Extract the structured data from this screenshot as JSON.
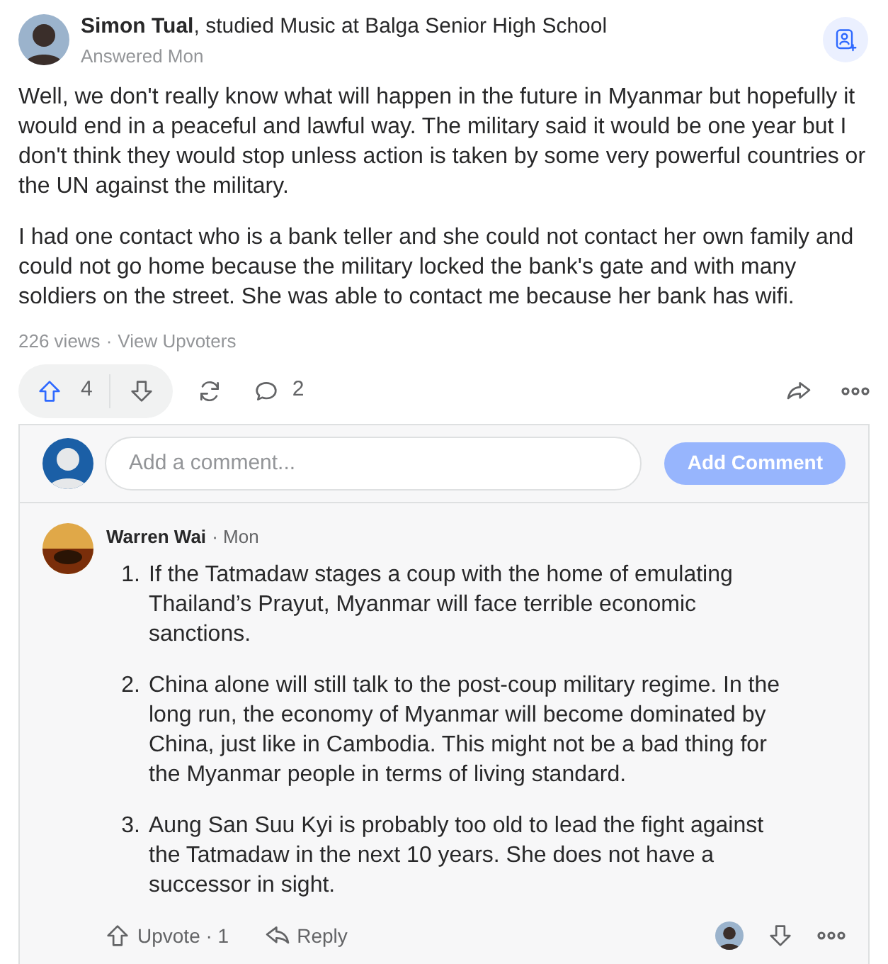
{
  "answer": {
    "author": "Simon Tual",
    "credential": ", studied Music at Balga Senior High School",
    "meta": "Answered Mon",
    "paragraphs": [
      "Well, we don't really know what will happen in the future in Myanmar but hopefully it would end in a peaceful and lawful way. The military said it would be one year but I don't think they would stop unless action is taken by some very powerful countries or the UN against the military.",
      "I had one contact who is a bank teller and she could not contact her own family and could not go home because the military locked the bank's gate and with many soldiers on the street. She was able to contact me because her bank has wifi."
    ],
    "views": "226 views",
    "separator": "·",
    "view_upvoters": "View Upvoters",
    "upvotes": "4",
    "comments": "2"
  },
  "comment_box": {
    "placeholder": "Add a comment...",
    "button": "Add Comment"
  },
  "comments": [
    {
      "author": "Warren Wai",
      "time": "· Mon",
      "points": [
        {
          "number": "1.",
          "text": "If the Tatmadaw stages a coup with the home of emulating Thailand’s Prayut, Myanmar will face terrible economic sanctions."
        },
        {
          "number": "2.",
          "text": "China alone will still talk to the post-coup military regime. In the long run, the economy of Myanmar will become dominated by China, just like in Cambodia. This might not be a bad thing for the Myanmar people in terms of living standard."
        },
        {
          "number": "3.",
          "text": "Aung San Suu Kyi is probably too old to lead the fight against the Tatmadaw in the next 10 years. She does not have a successor in sight."
        }
      ],
      "upvote": "Upvote · 1",
      "reply": "Reply"
    }
  ]
}
